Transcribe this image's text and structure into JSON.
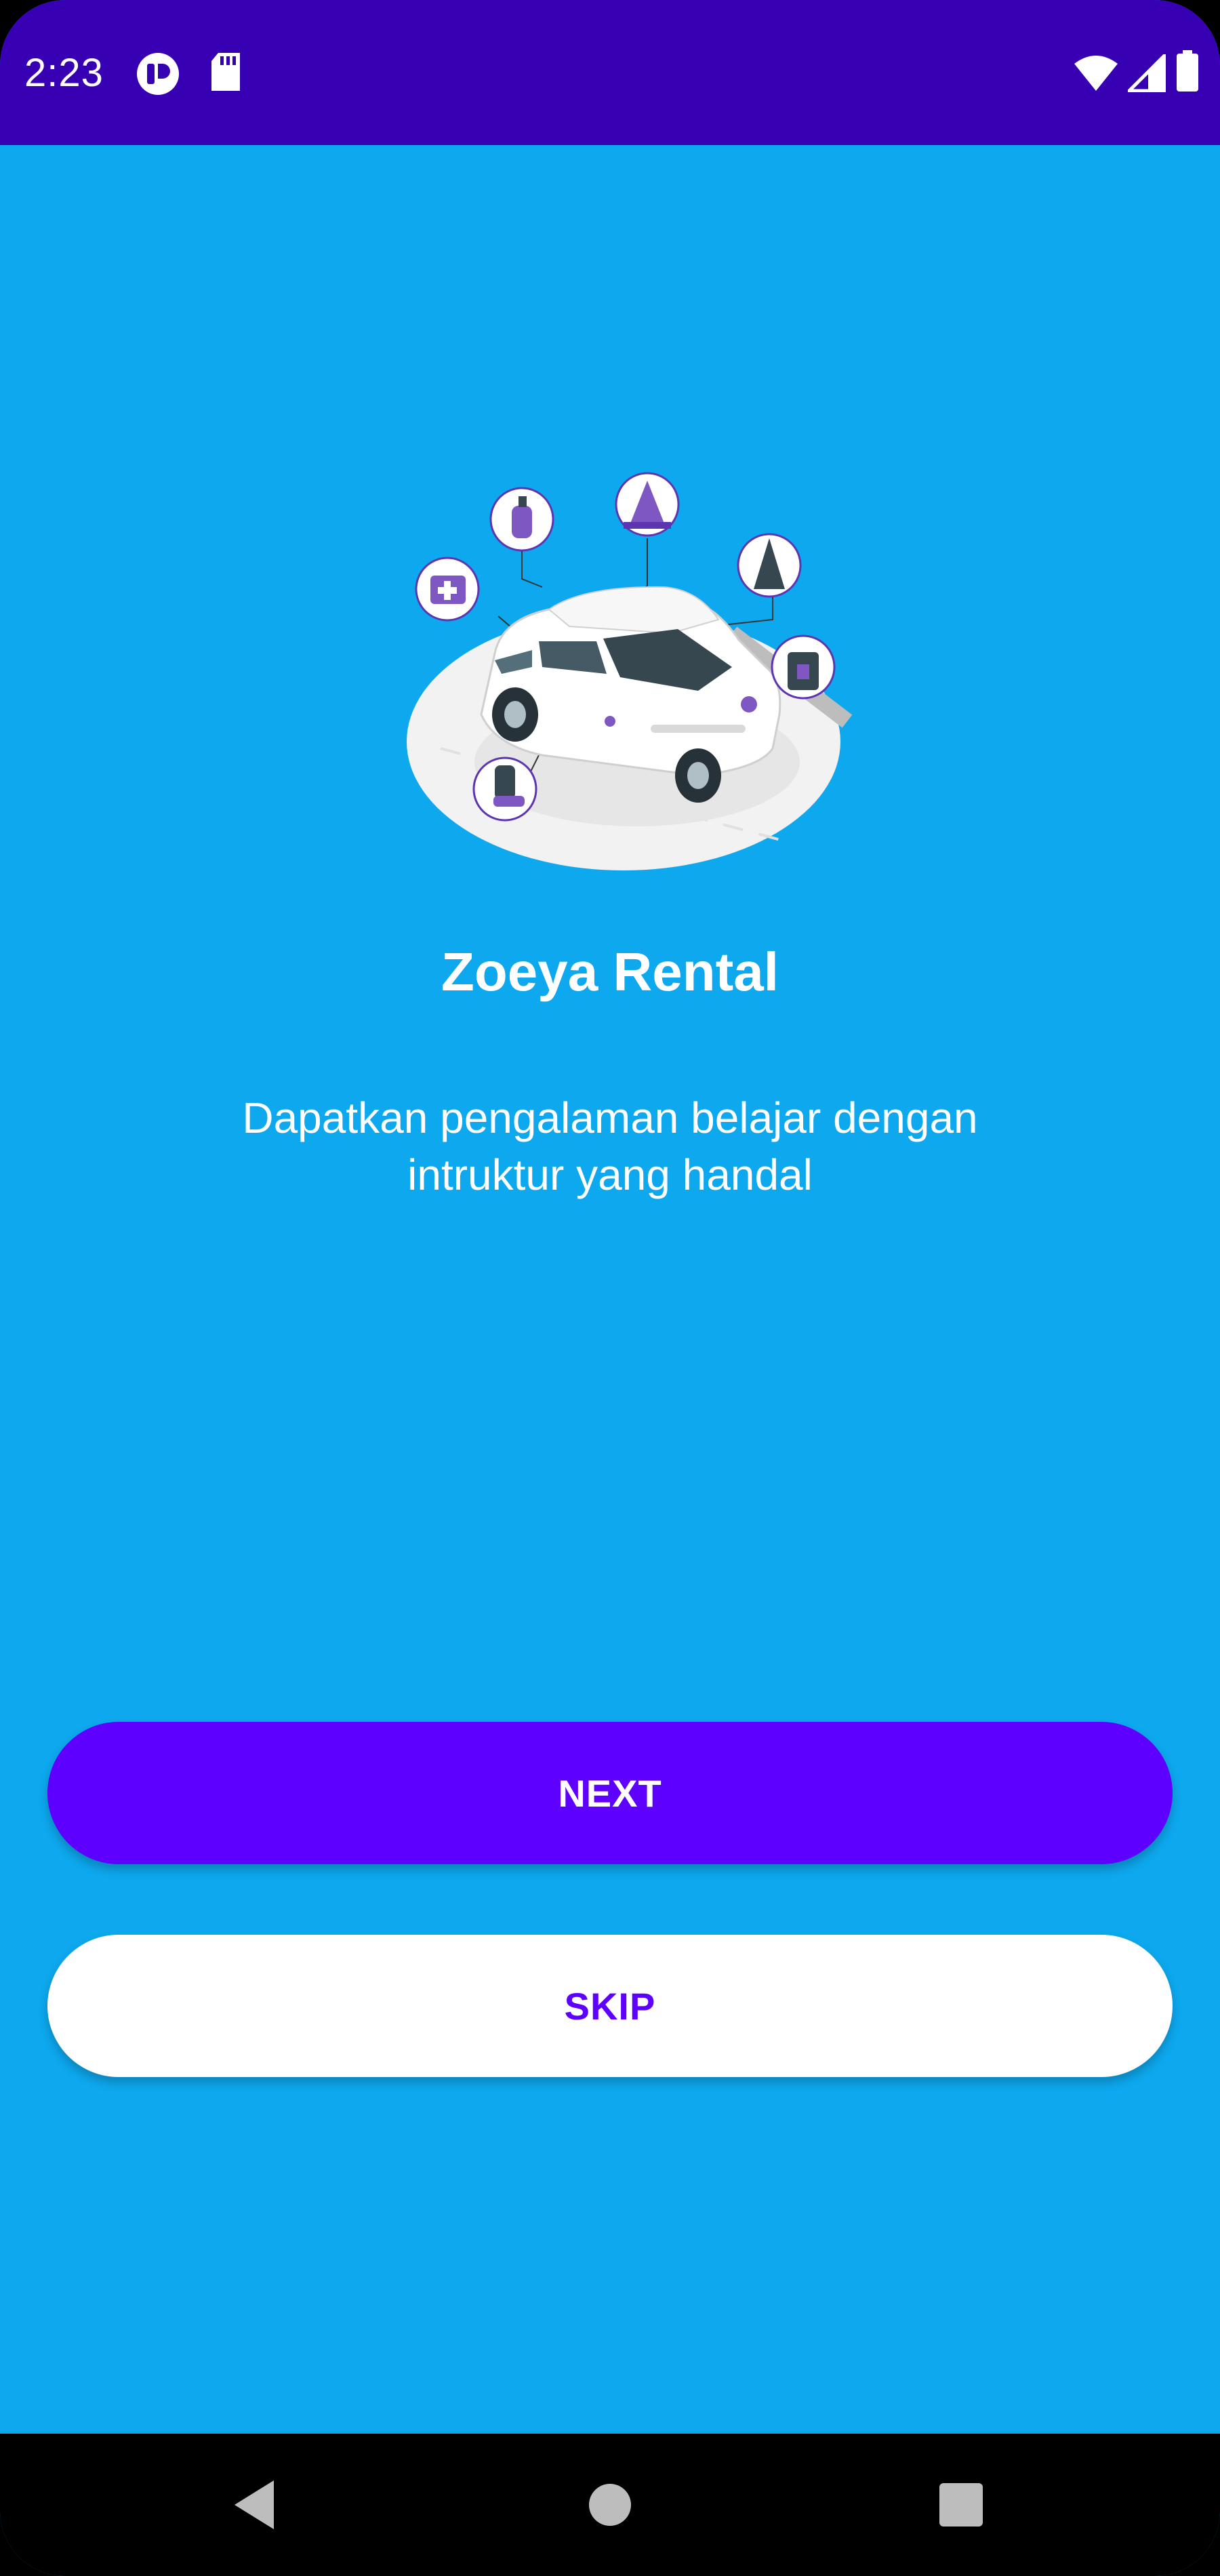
{
  "status_bar": {
    "time": "2:23",
    "left_icons": [
      "notification-app-icon",
      "sd-card-icon"
    ],
    "right_icons": [
      "wifi-icon",
      "cell-signal-icon",
      "battery-icon"
    ],
    "color": "#3700B3"
  },
  "onboarding": {
    "illustration": "car-rental-illustration",
    "title": "Zoeya Rental",
    "description": "Dapatkan pengalaman belajar dengan intruktur yang handal",
    "background_color": "#0DA8EE"
  },
  "actions": {
    "next_label": "NEXT",
    "skip_label": "SKIP",
    "accent_color": "#5E00FF"
  },
  "nav_bar": {
    "buttons": [
      "back-icon",
      "home-icon",
      "recents-icon"
    ]
  }
}
